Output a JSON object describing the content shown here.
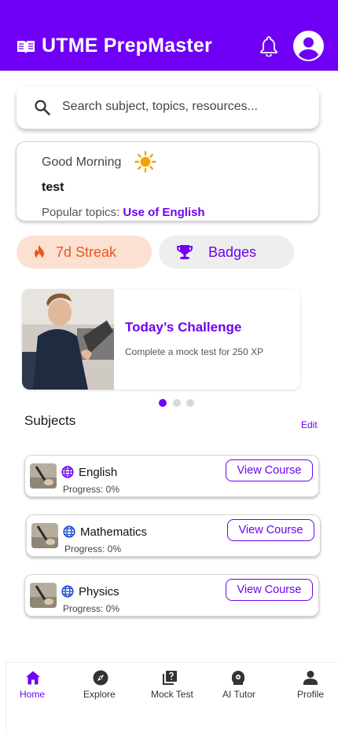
{
  "header": {
    "title": "UTME PrepMaster",
    "brand_color": "#6f00f5",
    "icons": [
      "book-icon",
      "bell-icon",
      "account-circle-icon"
    ]
  },
  "search": {
    "placeholder": "Search subject, topics, resources..."
  },
  "greeting": {
    "salutation": "Good Morning",
    "username": "test",
    "popular_label": "Popular topics: ",
    "popular_topic": "Use of English"
  },
  "chips": {
    "streak_label": "7d Streak",
    "badges_label": "Badges",
    "streak_color": "#e8581e"
  },
  "challenge": {
    "title": "Today’s Challenge",
    "description": "Complete a mock test for 250 XP",
    "carousel_pages": 3,
    "carousel_active_index": 0
  },
  "subjects": {
    "heading": "Subjects",
    "edit_label": "Edit",
    "items": [
      {
        "name": "English",
        "progress": "Progress: 0%",
        "button": "View Course"
      },
      {
        "name": "Mathematics",
        "progress": "Progress: 0%",
        "button": "View Course"
      },
      {
        "name": "Physics",
        "progress": "Progress: 0%",
        "button": "View Course"
      }
    ]
  },
  "bottom_nav": {
    "items": [
      {
        "label": "Home",
        "icon": "home-icon",
        "active": true
      },
      {
        "label": "Explore",
        "icon": "compass-icon",
        "active": false
      },
      {
        "label": "Mock Test",
        "icon": "quiz-icon",
        "active": false
      },
      {
        "label": "AI Tutor",
        "icon": "robot-icon",
        "active": false
      },
      {
        "label": "Profile",
        "icon": "person-icon",
        "active": false
      }
    ]
  }
}
